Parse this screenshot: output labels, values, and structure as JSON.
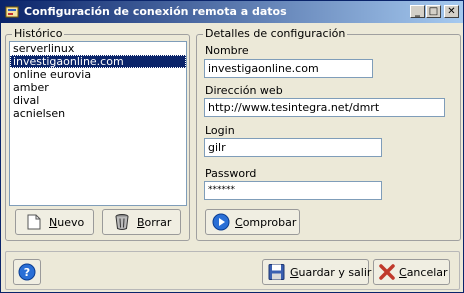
{
  "window": {
    "title": "Configuración de conexión remota a datos"
  },
  "titlebar": {
    "minimize": "_",
    "maximize": "□",
    "close": "✕"
  },
  "history": {
    "legend": "Histórico",
    "items": [
      "serverlinux",
      "investigaonline.com",
      "online eurovia",
      "amber",
      "dival",
      "acnielsen"
    ],
    "selected_index": 1,
    "new_label_ul": "N",
    "new_label_rest": "uevo",
    "delete_label_ul": "B",
    "delete_label_rest": "orrar"
  },
  "details": {
    "legend": "Detalles de configuración",
    "name_label": "Nombre",
    "name_value": "investigaonline.com",
    "url_label": "Dirección web",
    "url_value": "http://www.tesintegra.net/dmrt",
    "login_label": "Login",
    "login_value": "gilr",
    "password_label": "Password",
    "password_value": "******",
    "check_label_ul": "C",
    "check_label_rest": "omprobar"
  },
  "footer": {
    "help": "?",
    "save_label_ul": "G",
    "save_label_rest": "uardar y salir",
    "cancel_label_ul": "C",
    "cancel_label_rest": "ancelar"
  },
  "colors": {
    "titlebar_start": "#0a246a",
    "titlebar_end": "#a6caf0",
    "selection": "#0a246a",
    "face": "#ece9d8"
  }
}
